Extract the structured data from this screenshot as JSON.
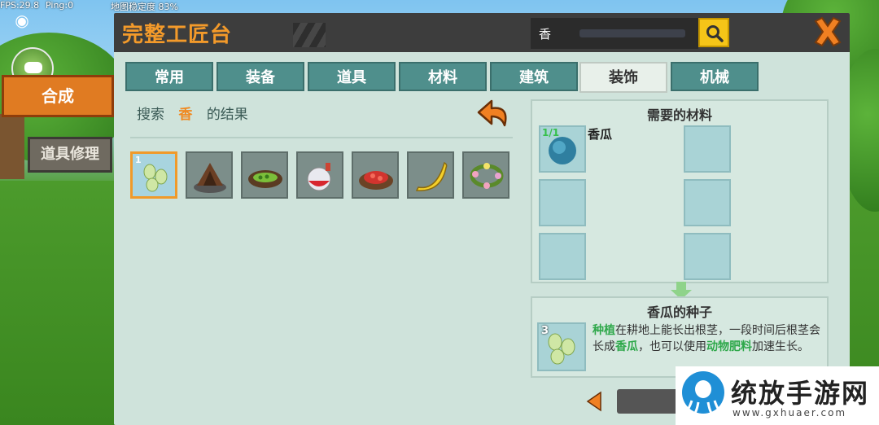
{
  "hud": {
    "fps": "FPS:29.8",
    "ping": "Ping:0",
    "stability": "地图稳定度 83%"
  },
  "side_tabs": {
    "craft": "合成",
    "repair": "道具修理"
  },
  "panel": {
    "title": "完整工匠台",
    "search_value": "香"
  },
  "tabs": [
    {
      "label": "常用",
      "active": false
    },
    {
      "label": "装备",
      "active": false
    },
    {
      "label": "道具",
      "active": false
    },
    {
      "label": "材料",
      "active": false
    },
    {
      "label": "建筑",
      "active": false
    },
    {
      "label": "装饰",
      "active": true
    },
    {
      "label": "机械",
      "active": false
    }
  ],
  "results": {
    "prefix": "搜索",
    "keyword": "香",
    "suffix": "的结果",
    "items": [
      {
        "icon": "melon-seeds-icon",
        "count": "1",
        "selected": true
      },
      {
        "icon": "campfire-icon",
        "count": "",
        "selected": false
      },
      {
        "icon": "veggie-plate-icon",
        "count": "",
        "selected": false
      },
      {
        "icon": "potion-icon",
        "count": "",
        "selected": false
      },
      {
        "icon": "meat-plate-icon",
        "count": "",
        "selected": false
      },
      {
        "icon": "banana-icon",
        "count": "",
        "selected": false
      },
      {
        "icon": "flower-wreath-icon",
        "count": "",
        "selected": false
      }
    ]
  },
  "materials": {
    "title": "需要的材料",
    "first": {
      "count": "1/1",
      "name": "香瓜",
      "icon": "melon-icon"
    }
  },
  "product": {
    "title": "香瓜的种子",
    "count": "3",
    "desc_1": "种植",
    "desc_2": "在耕地上能长出根茎，一段时间后根茎会长成",
    "desc_3": "香瓜",
    "desc_4": "，也可以使用",
    "desc_5": "动物肥料",
    "desc_6": "加速生长。"
  },
  "watermark": {
    "main": "统放手游网",
    "sub": "www.gxhuaer.com"
  },
  "colors": {
    "accent_orange": "#f39a2a",
    "tab_teal": "#4f8f8c",
    "panel_bg": "#cfe3db",
    "highlight_green": "#2ea84a"
  }
}
